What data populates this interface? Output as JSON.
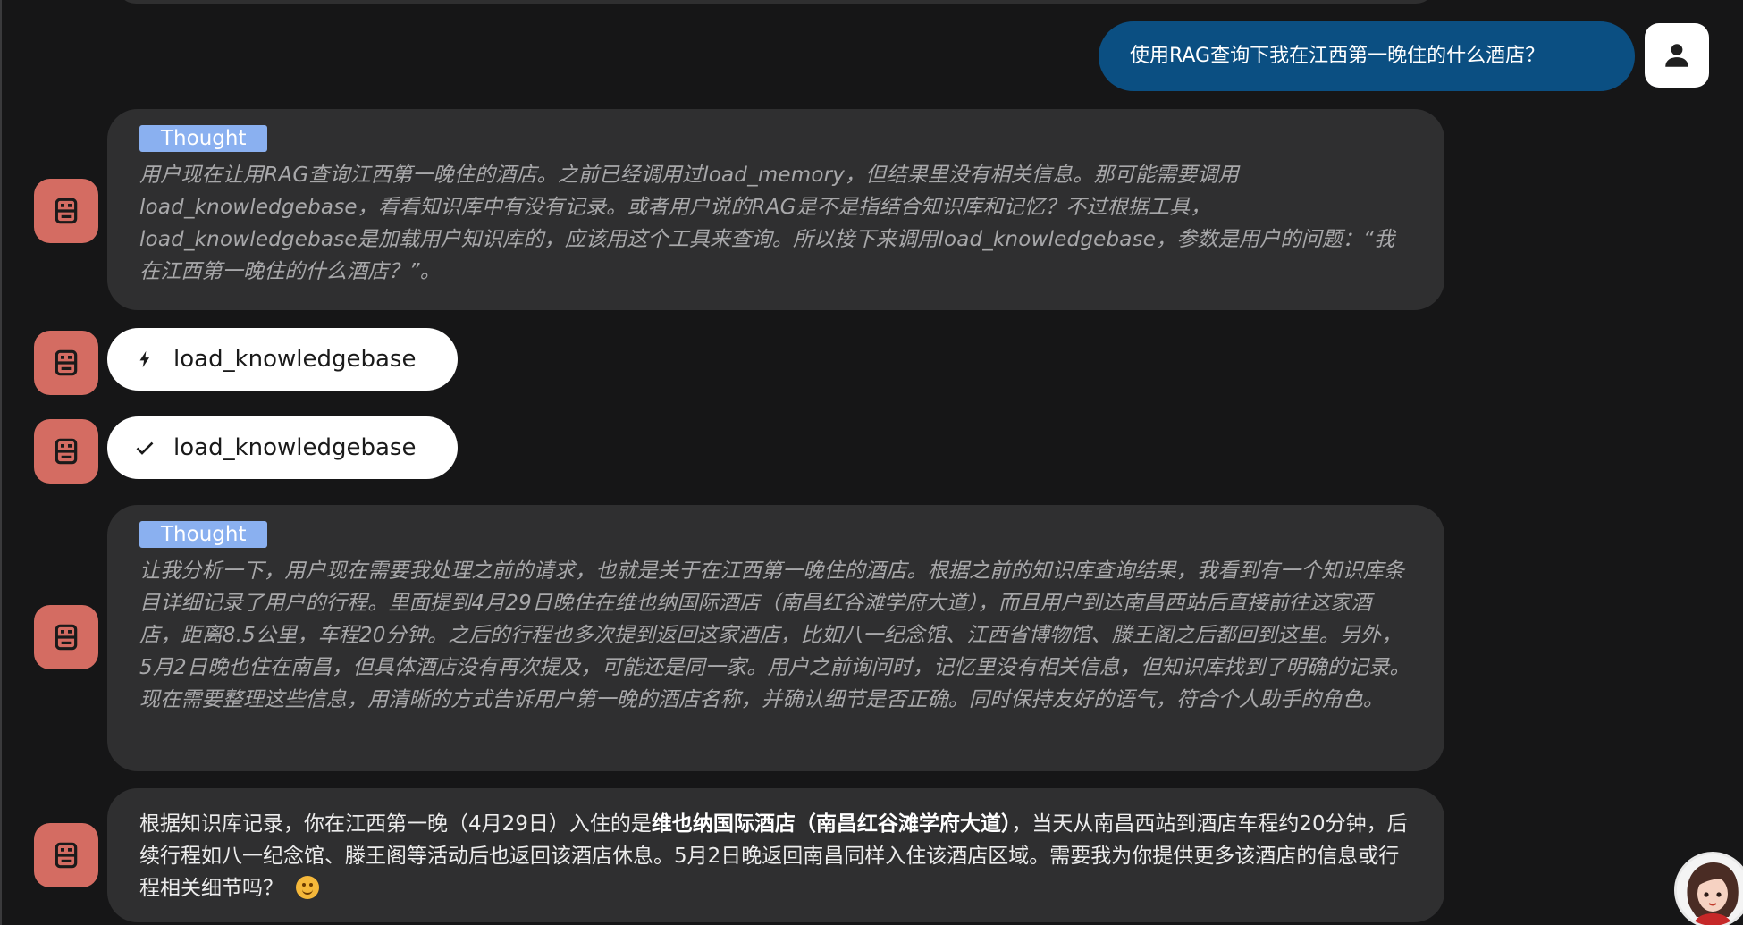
{
  "user_message": {
    "text": "使用RAG查询下我在江西第一晚住的什么酒店？",
    "avatar_icon": "person-icon"
  },
  "bot_avatar_icon": "robot-icon",
  "thought_1": {
    "badge": "Thought",
    "text": "用户现在让用RAG查询江西第一晚住的酒店。之前已经调用过load_memory，但结果里没有相关信息。那可能需要调用load_knowledgebase，看看知识库中有没有记录。或者用户说的RAG是不是指结合知识库和记忆？不过根据工具，load_knowledgebase是加载用户知识库的，应该用这个工具来查询。所以接下来调用load_knowledgebase，参数是用户的问题：“我在江西第一晚住的什么酒店？”。"
  },
  "tool_call": {
    "name": "load_knowledgebase",
    "icon": "lightning-bolt-icon"
  },
  "tool_result": {
    "name": "load_knowledgebase",
    "icon": "checkmark-icon"
  },
  "thought_2": {
    "badge": "Thought",
    "text": "让我分析一下，用户现在需要我处理之前的请求，也就是关于在江西第一晚住的酒店。根据之前的知识库查询结果，我看到有一个知识库条目详细记录了用户的行程。里面提到4月29日晚住在维也纳国际酒店（南昌红谷滩学府大道），而且用户到达南昌西站后直接前往这家酒店，距离8.5公里，车程20分钟。之后的行程也多次提到返回这家酒店，比如八一纪念馆、江西省博物馆、滕王阁之后都回到这里。另外，5月2日晚也住在南昌，但具体酒店没有再次提及，可能还是同一家。用户之前询问时，记忆里没有相关信息，但知识库找到了明确的记录。现在需要整理这些信息，用清晰的方式告诉用户第一晚的酒店名称，并确认细节是否正确。同时保持友好的语气，符合个人助手的角色。"
  },
  "answer": {
    "before": "根据知识库记录，你在江西第一晚（4月29日）入住的是",
    "bold": "维也纳国际酒店（南昌红谷滩学府大道）",
    "after": "，当天从南昌西站到酒店车程约20分钟，后续行程如八一纪念馆、滕王阁等活动后也返回该酒店休息。5月2日晚返回南昌同样入住该酒店区域。需要我为你提供更多该酒店的信息或行程相关细节吗？",
    "emoji": "smiling-face-emoji"
  },
  "corner_avatar_icon": "assistant-portrait-avatar"
}
